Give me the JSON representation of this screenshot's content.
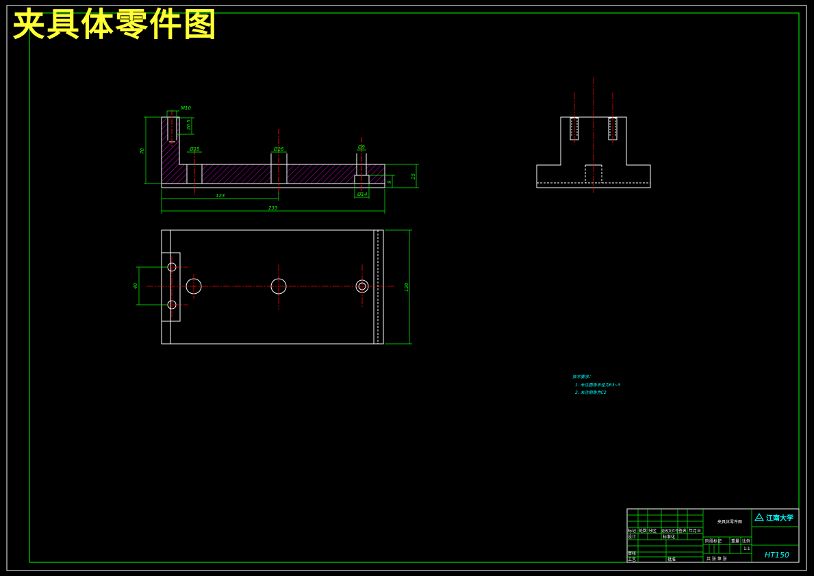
{
  "title": "夹具体零件图",
  "dimensions": {
    "front_view": [
      "M10",
      "20.5",
      "70",
      "Ø35",
      "Ø26",
      "Ø9",
      "Ø14",
      "123",
      "233",
      "25",
      "9"
    ],
    "plan_view": [
      "40",
      "120"
    ]
  },
  "tech_notes": {
    "heading": "技术要求：",
    "items": [
      "1. 未注圆角半径为R3~5",
      "2. 未注倒角为C2"
    ]
  },
  "title_block": {
    "part_name": "夹具体零件图",
    "school": "江南大学",
    "material": "HT150",
    "scale_label": "比例",
    "weight_label": "重量",
    "stage_label": "阶段标记",
    "sheet_label": "共    张    第    张",
    "scale_value": "1:1",
    "header_cells": [
      "标记",
      "处数",
      "分区",
      "更改文件号",
      "签名",
      "年月日"
    ],
    "role_design": "设计",
    "role_standard": "标准化",
    "role_check": "审核",
    "role_process": "工艺",
    "role_approve": "批准"
  },
  "colors": {
    "frame": "#00ff00",
    "outline": "#ffffff",
    "centerline": "#ff0000",
    "hatch": "#ff00ff",
    "title": "#ffff33",
    "note": "#00ffff"
  }
}
